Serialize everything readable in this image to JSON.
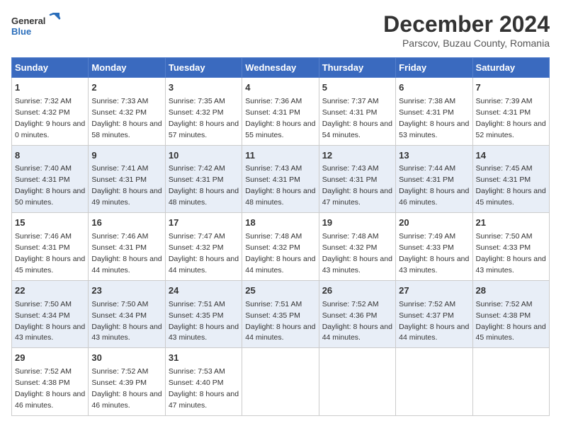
{
  "logo": {
    "general": "General",
    "blue": "Blue"
  },
  "title": "December 2024",
  "subtitle": "Parscov, Buzau County, Romania",
  "days_header": [
    "Sunday",
    "Monday",
    "Tuesday",
    "Wednesday",
    "Thursday",
    "Friday",
    "Saturday"
  ],
  "weeks": [
    [
      {
        "day": "1",
        "sunrise": "7:32 AM",
        "sunset": "4:32 PM",
        "daylight": "9 hours and 0 minutes."
      },
      {
        "day": "2",
        "sunrise": "7:33 AM",
        "sunset": "4:32 PM",
        "daylight": "8 hours and 58 minutes."
      },
      {
        "day": "3",
        "sunrise": "7:35 AM",
        "sunset": "4:32 PM",
        "daylight": "8 hours and 57 minutes."
      },
      {
        "day": "4",
        "sunrise": "7:36 AM",
        "sunset": "4:31 PM",
        "daylight": "8 hours and 55 minutes."
      },
      {
        "day": "5",
        "sunrise": "7:37 AM",
        "sunset": "4:31 PM",
        "daylight": "8 hours and 54 minutes."
      },
      {
        "day": "6",
        "sunrise": "7:38 AM",
        "sunset": "4:31 PM",
        "daylight": "8 hours and 53 minutes."
      },
      {
        "day": "7",
        "sunrise": "7:39 AM",
        "sunset": "4:31 PM",
        "daylight": "8 hours and 52 minutes."
      }
    ],
    [
      {
        "day": "8",
        "sunrise": "7:40 AM",
        "sunset": "4:31 PM",
        "daylight": "8 hours and 50 minutes."
      },
      {
        "day": "9",
        "sunrise": "7:41 AM",
        "sunset": "4:31 PM",
        "daylight": "8 hours and 49 minutes."
      },
      {
        "day": "10",
        "sunrise": "7:42 AM",
        "sunset": "4:31 PM",
        "daylight": "8 hours and 48 minutes."
      },
      {
        "day": "11",
        "sunrise": "7:43 AM",
        "sunset": "4:31 PM",
        "daylight": "8 hours and 48 minutes."
      },
      {
        "day": "12",
        "sunrise": "7:43 AM",
        "sunset": "4:31 PM",
        "daylight": "8 hours and 47 minutes."
      },
      {
        "day": "13",
        "sunrise": "7:44 AM",
        "sunset": "4:31 PM",
        "daylight": "8 hours and 46 minutes."
      },
      {
        "day": "14",
        "sunrise": "7:45 AM",
        "sunset": "4:31 PM",
        "daylight": "8 hours and 45 minutes."
      }
    ],
    [
      {
        "day": "15",
        "sunrise": "7:46 AM",
        "sunset": "4:31 PM",
        "daylight": "8 hours and 45 minutes."
      },
      {
        "day": "16",
        "sunrise": "7:46 AM",
        "sunset": "4:31 PM",
        "daylight": "8 hours and 44 minutes."
      },
      {
        "day": "17",
        "sunrise": "7:47 AM",
        "sunset": "4:32 PM",
        "daylight": "8 hours and 44 minutes."
      },
      {
        "day": "18",
        "sunrise": "7:48 AM",
        "sunset": "4:32 PM",
        "daylight": "8 hours and 44 minutes."
      },
      {
        "day": "19",
        "sunrise": "7:48 AM",
        "sunset": "4:32 PM",
        "daylight": "8 hours and 43 minutes."
      },
      {
        "day": "20",
        "sunrise": "7:49 AM",
        "sunset": "4:33 PM",
        "daylight": "8 hours and 43 minutes."
      },
      {
        "day": "21",
        "sunrise": "7:50 AM",
        "sunset": "4:33 PM",
        "daylight": "8 hours and 43 minutes."
      }
    ],
    [
      {
        "day": "22",
        "sunrise": "7:50 AM",
        "sunset": "4:34 PM",
        "daylight": "8 hours and 43 minutes."
      },
      {
        "day": "23",
        "sunrise": "7:50 AM",
        "sunset": "4:34 PM",
        "daylight": "8 hours and 43 minutes."
      },
      {
        "day": "24",
        "sunrise": "7:51 AM",
        "sunset": "4:35 PM",
        "daylight": "8 hours and 43 minutes."
      },
      {
        "day": "25",
        "sunrise": "7:51 AM",
        "sunset": "4:35 PM",
        "daylight": "8 hours and 44 minutes."
      },
      {
        "day": "26",
        "sunrise": "7:52 AM",
        "sunset": "4:36 PM",
        "daylight": "8 hours and 44 minutes."
      },
      {
        "day": "27",
        "sunrise": "7:52 AM",
        "sunset": "4:37 PM",
        "daylight": "8 hours and 44 minutes."
      },
      {
        "day": "28",
        "sunrise": "7:52 AM",
        "sunset": "4:38 PM",
        "daylight": "8 hours and 45 minutes."
      }
    ],
    [
      {
        "day": "29",
        "sunrise": "7:52 AM",
        "sunset": "4:38 PM",
        "daylight": "8 hours and 46 minutes."
      },
      {
        "day": "30",
        "sunrise": "7:52 AM",
        "sunset": "4:39 PM",
        "daylight": "8 hours and 46 minutes."
      },
      {
        "day": "31",
        "sunrise": "7:53 AM",
        "sunset": "4:40 PM",
        "daylight": "8 hours and 47 minutes."
      },
      null,
      null,
      null,
      null
    ]
  ]
}
